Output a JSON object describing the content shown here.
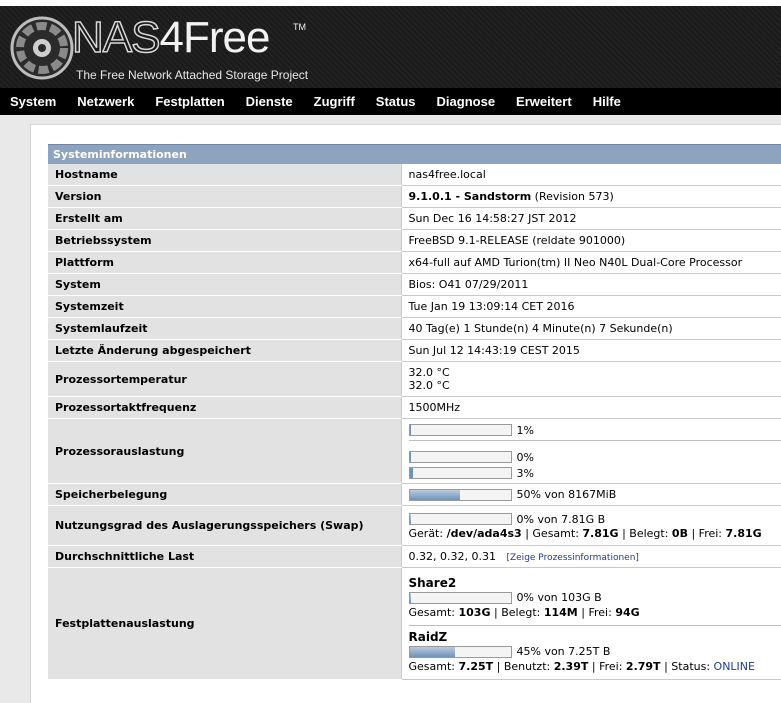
{
  "header": {
    "logo_nas": "NAS",
    "logo_four": "4Free",
    "logo_tm": "TM",
    "subtitle": "The Free Network Attached Storage Project"
  },
  "nav": [
    "System",
    "Netzwerk",
    "Festplatten",
    "Dienste",
    "Zugriff",
    "Status",
    "Diagnose",
    "Erweitert",
    "Hilfe"
  ],
  "section_title": "Systeminformationen",
  "rows": {
    "hostname": {
      "label": "Hostname",
      "value": "nas4free.local"
    },
    "version": {
      "label": "Version",
      "value_bold": "9.1.0.1 - Sandstorm",
      "value_rest": " (Revision 573)"
    },
    "built": {
      "label": "Erstellt am",
      "value": "Sun Dec 16 14:58:27 JST 2012"
    },
    "os": {
      "label": "Betriebssystem",
      "value": "FreeBSD 9.1-RELEASE (reldate 901000)"
    },
    "platform": {
      "label": "Plattform",
      "value": "x64-full auf AMD Turion(tm) II Neo N40L Dual-Core Processor"
    },
    "system": {
      "label": "System",
      "value": "Bios: O41 07/29/2011"
    },
    "systime": {
      "label": "Systemzeit",
      "value": "Tue Jan 19 13:09:14 CET 2016"
    },
    "uptime": {
      "label": "Systemlaufzeit",
      "value": "40 Tag(e) 1 Stunde(n) 4 Minute(n) 7 Sekunde(n)"
    },
    "lastchange": {
      "label": "Letzte Änderung abgespeichert",
      "value": "Sun Jul 12 14:43:19 CEST 2015"
    },
    "cputemp": {
      "label": "Prozessortemperatur",
      "line1": "32.0  °C",
      "line2": "32.0  °C"
    },
    "cpufreq": {
      "label": "Prozessortaktfrequenz",
      "value": "1500MHz"
    },
    "cpuload": {
      "label": "Prozessorauslastung",
      "bars": [
        {
          "pct_text": "1%",
          "fraction": 0.01
        },
        {
          "pct_text": "0%",
          "fraction": 0.0
        },
        {
          "pct_text": "3%",
          "fraction": 0.03
        }
      ]
    },
    "memory": {
      "label": "Speicherbelegung",
      "fraction": 0.5,
      "text": "50% von 8167MiB"
    },
    "swap": {
      "label": "Nutzungsgrad des Auslagerungsspeichers (Swap)",
      "fraction": 0.0,
      "text": "0% von 7.81G B",
      "device_label": "Gerät: ",
      "device": "/dev/ada4s3",
      "total_label": " | Gesamt: ",
      "total": "7.81G",
      "used_label": " | Belegt: ",
      "used": "0B",
      "free_label": " | Frei: ",
      "free": "7.81G"
    },
    "load": {
      "label": "Durchschnittliche Last",
      "value": "0.32, 0.32, 0.31",
      "link": "Zeige Prozessinformationen"
    },
    "disks": {
      "label": "Festplattenauslastung",
      "pools": [
        {
          "name": "Share2",
          "fraction": 0.0,
          "text": "0% von 103G B",
          "l1": "Gesamt: ",
          "v1": "103G",
          "l2": " | Belegt: ",
          "v2": "114M",
          "l3": " | Frei: ",
          "v3": "94G"
        },
        {
          "name": "RaidZ",
          "fraction": 0.45,
          "text": "45% von 7.25T B",
          "l1": "Gesamt: ",
          "v1": "7.25T",
          "l2": " | Benutzt: ",
          "v2": "2.39T",
          "l3": " | Frei: ",
          "v3": "2.79T",
          "l4": " | Status: ",
          "v4": "ONLINE"
        }
      ]
    }
  },
  "colors": {
    "section": "#8ea3bd",
    "label_bg": "#e2e2e2",
    "bar_fill": "#6f92b8",
    "link": "#1f3b8a"
  }
}
